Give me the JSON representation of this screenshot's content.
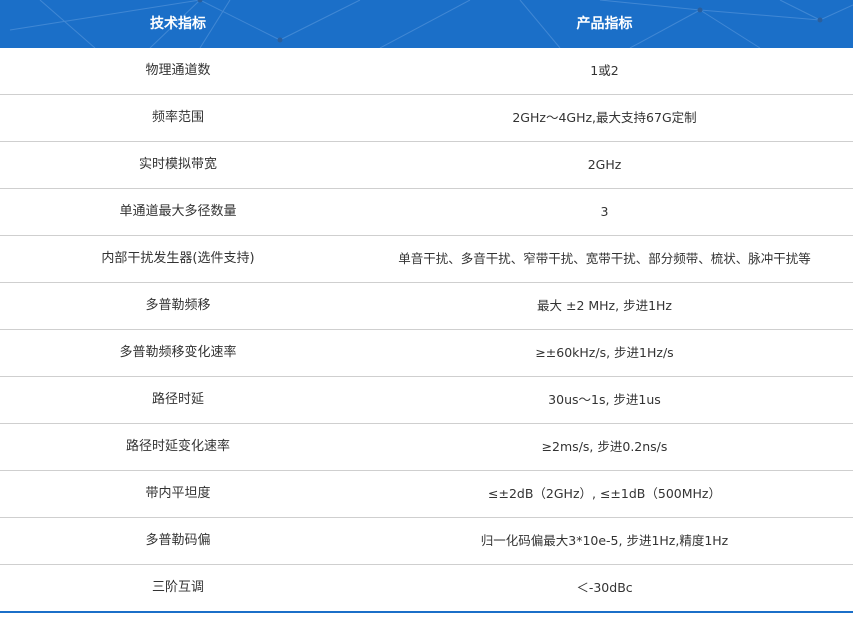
{
  "header": {
    "col1": "技术指标",
    "col2": "产品指标"
  },
  "rows": [
    {
      "name": "物理通道数",
      "value": "1或2"
    },
    {
      "name": "频率范围",
      "value": "2GHz～4GHz,最大支持67G定制"
    },
    {
      "name": "实时模拟带宽",
      "value": "2GHz"
    },
    {
      "name": "单通道最大多径数量",
      "value": "3"
    },
    {
      "name": "内部干扰发生器(选件支持)",
      "value": "单音干扰、多音干扰、窄带干扰、宽带干扰、部分频带、梳状、脉冲干扰等"
    },
    {
      "name": "多普勒频移",
      "value": "最大 ±2 MHz, 步进1Hz"
    },
    {
      "name": "多普勒频移变化速率",
      "value": "≥±60kHz/s, 步进1Hz/s"
    },
    {
      "name": "路径时延",
      "value": "30us～1s, 步进1us"
    },
    {
      "name": "路径时延变化速率",
      "value": "≥2ms/s, 步进0.2ns/s"
    },
    {
      "name": "带内平坦度",
      "value": "≤±2dB（2GHz）, ≤±1dB（500MHz）"
    },
    {
      "name": "多普勒码偏",
      "value": "归一化码偏最大3*10e-5, 步进1Hz,精度1Hz"
    },
    {
      "name": "三阶互调",
      "value": "＜-30dBc"
    }
  ]
}
